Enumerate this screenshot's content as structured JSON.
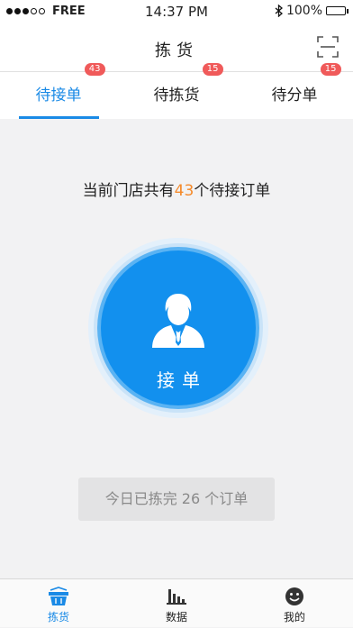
{
  "status_bar": {
    "carrier": "FREE",
    "time": "14:37 PM",
    "battery": "100%"
  },
  "header": {
    "title": "拣货"
  },
  "tabs": [
    {
      "label": "待接单",
      "badge": "43"
    },
    {
      "label": "待拣货",
      "badge": "15"
    },
    {
      "label": "待分单",
      "badge": "15"
    }
  ],
  "summary": {
    "prefix": "当前门店共有",
    "count": "43",
    "suffix": "个待接订单"
  },
  "accept": {
    "label": "接单"
  },
  "today": {
    "text": "今日已拣完 26 个订单"
  },
  "bottom_nav": [
    {
      "label": "拣货",
      "icon": "basket-icon"
    },
    {
      "label": "数据",
      "icon": "bar-chart-icon"
    },
    {
      "label": "我的",
      "icon": "smiley-icon"
    }
  ],
  "colors": {
    "accent": "#1a8ae6",
    "badge": "#f05a5a",
    "highlight": "#f58a2a"
  }
}
